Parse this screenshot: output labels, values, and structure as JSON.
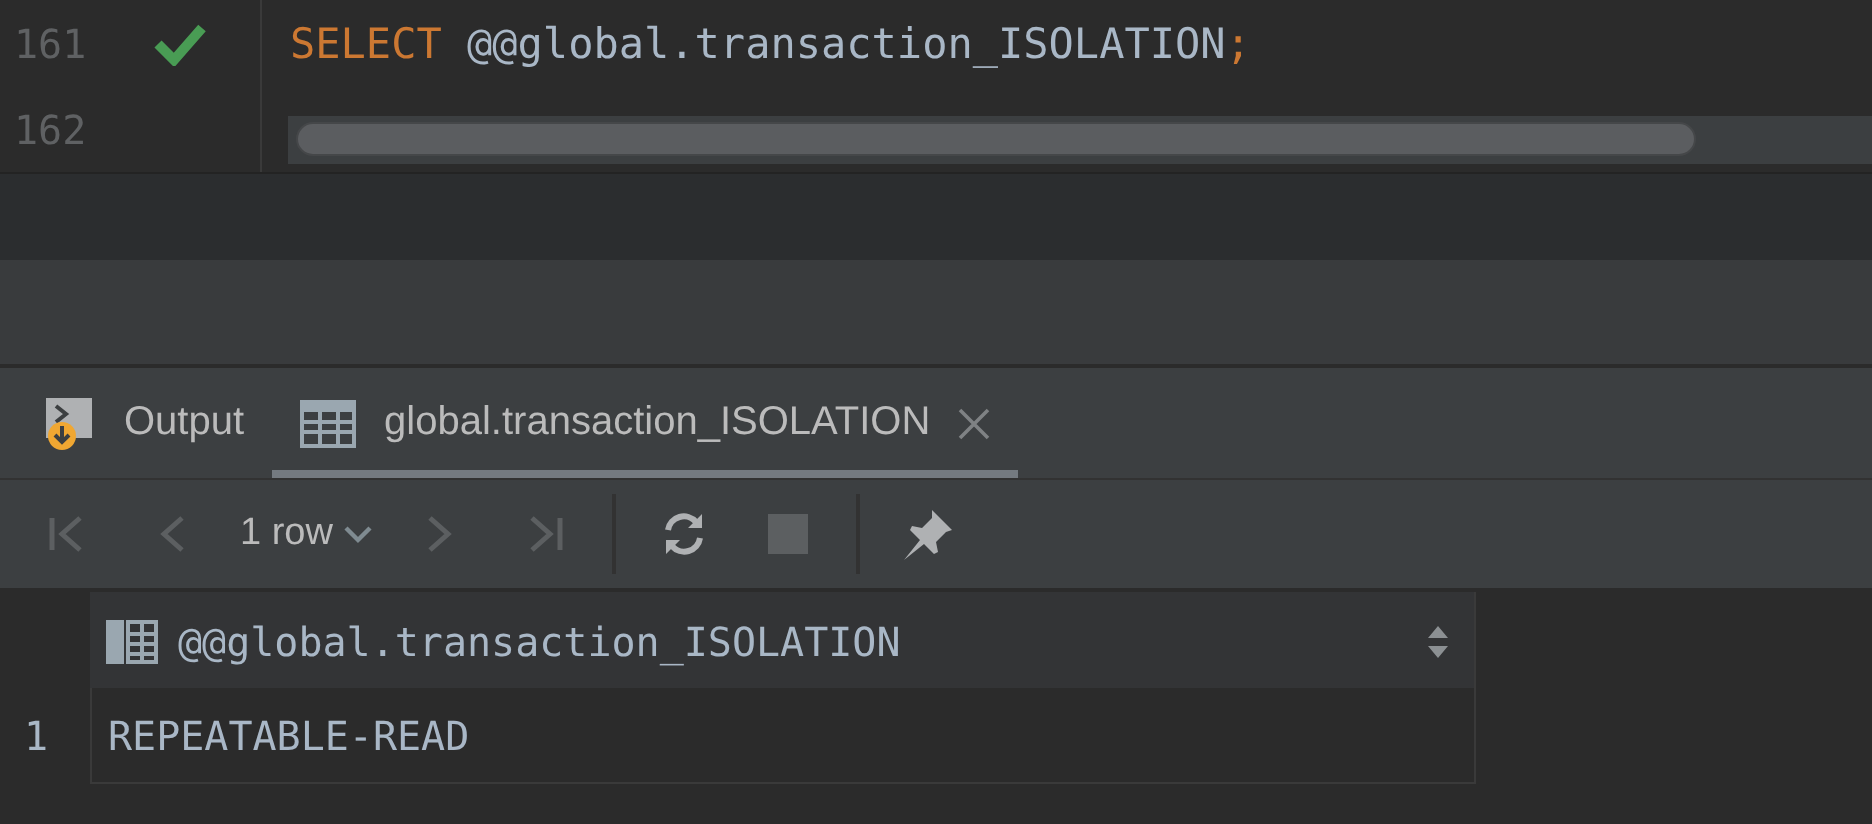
{
  "editor": {
    "lines": [
      {
        "number": "161",
        "executed": true,
        "tokens": [
          {
            "kind": "keyword",
            "text": "SELECT"
          },
          {
            "kind": "plain",
            "text": " @@global.transaction_ISOLATION"
          },
          {
            "kind": "punct",
            "text": ";"
          }
        ]
      },
      {
        "number": "162",
        "executed": false
      }
    ]
  },
  "results": {
    "tabs": [
      {
        "label": "Output",
        "kind": "output",
        "selected": false,
        "closable": false
      },
      {
        "label": "global.transaction_ISOLATION",
        "kind": "table",
        "selected": true,
        "closable": true
      }
    ],
    "toolbar": [
      {
        "kind": "first",
        "disabled": true
      },
      {
        "kind": "prev",
        "disabled": true
      },
      {
        "kind": "rows",
        "label": "1 row"
      },
      {
        "kind": "next",
        "disabled": true
      },
      {
        "kind": "last",
        "disabled": true
      },
      {
        "kind": "separator"
      },
      {
        "kind": "refresh",
        "disabled": false
      },
      {
        "kind": "stop",
        "disabled": true
      },
      {
        "kind": "separator"
      },
      {
        "kind": "pin",
        "disabled": false
      }
    ],
    "table": {
      "columns": [
        "@@global.transaction_ISOLATION"
      ],
      "rows": [
        {
          "number": "1",
          "cells": [
            "REPEATABLE-READ"
          ]
        }
      ]
    }
  }
}
